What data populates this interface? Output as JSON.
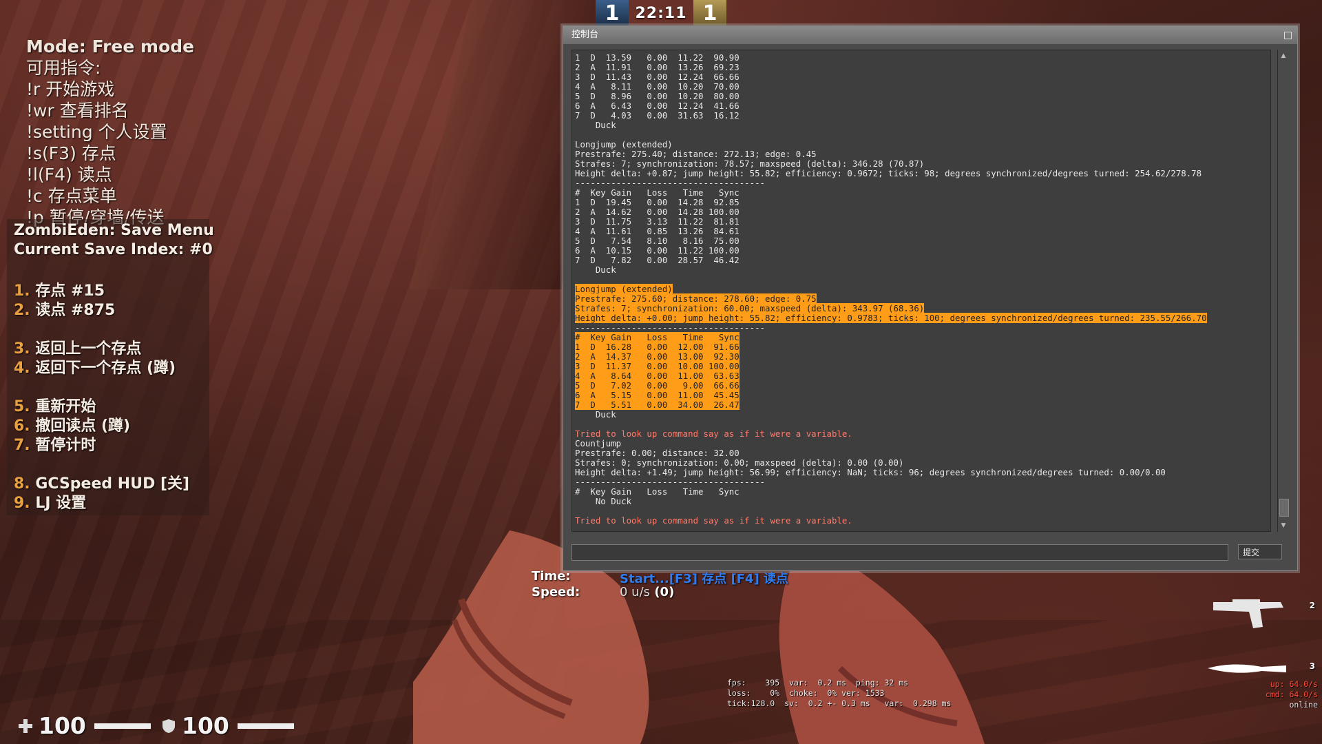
{
  "scoreboard": {
    "ct_score": "1",
    "round_time": "22:11",
    "t_score": "1"
  },
  "chat_menu": {
    "lines": [
      "Mode: Free mode",
      "可用指令:",
      "!r 开始游戏",
      "!wr 查看排名",
      "!setting 个人设置",
      "!s(F3) 存点",
      "!l(F4) 读点",
      "!c 存点菜单",
      "!p 暂停/穿墙/传送"
    ]
  },
  "save_menu": {
    "title": "ZombiEden: Save Menu",
    "index_label": "Current Save Index: #0",
    "items": [
      {
        "num": "1.",
        "label": "存点 #15"
      },
      {
        "num": "2.",
        "label": "读点 #875"
      },
      {
        "num": "3.",
        "label": "返回上一个存点"
      },
      {
        "num": "4.",
        "label": "返回下一个存点 (蹲)"
      },
      {
        "num": "5.",
        "label": "重新开始"
      },
      {
        "num": "6.",
        "label": "撤回读点 (蹲)"
      },
      {
        "num": "7.",
        "label": "暂停计时"
      },
      {
        "num": "8.",
        "label": "GCSpeed HUD [关]"
      },
      {
        "num": "9.",
        "label": "LJ 设置"
      }
    ]
  },
  "console": {
    "title": "控制台",
    "submit_label": "提交",
    "lines": [
      {
        "t": "1  D  13.59   0.00  11.22  90.90"
      },
      {
        "t": "2  A  11.91   0.00  13.26  69.23"
      },
      {
        "t": "3  D  11.43   0.00  12.24  66.66"
      },
      {
        "t": "4  A   8.11   0.00  10.20  70.00"
      },
      {
        "t": "5  D   8.96   0.00  10.20  80.00"
      },
      {
        "t": "6  A   6.43   0.00  12.24  41.66"
      },
      {
        "t": "7  D   4.03   0.00  31.63  16.12"
      },
      {
        "t": "    Duck"
      },
      {
        "t": ""
      },
      {
        "t": "Longjump (extended)"
      },
      {
        "t": "Prestrafe: 275.40; distance: 272.13; edge: 0.45"
      },
      {
        "t": "Strafes: 7; synchronization: 78.57; maxspeed (delta): 346.28 (70.87)"
      },
      {
        "t": "Height delta: +0.87; jump height: 55.82; efficiency: 0.9672; ticks: 98; degrees synchronized/degrees turned: 254.62/278.78"
      },
      {
        "t": "-------------------------------------"
      },
      {
        "t": "#  Key Gain   Loss   Time   Sync"
      },
      {
        "t": "1  D  19.45   0.00  14.28  92.85"
      },
      {
        "t": "2  A  14.62   0.00  14.28 100.00"
      },
      {
        "t": "3  D  11.75   3.13  11.22  81.81"
      },
      {
        "t": "4  A  11.61   0.85  13.26  84.61"
      },
      {
        "t": "5  D   7.54   8.10   8.16  75.00"
      },
      {
        "t": "6  A  10.15   0.00  11.22 100.00"
      },
      {
        "t": "7  D   7.82   0.00  28.57  46.42"
      },
      {
        "t": "    Duck"
      },
      {
        "t": ""
      },
      {
        "t": "Longjump (extended)",
        "hl": true
      },
      {
        "t": "Prestrafe: 275.60; distance: 278.60; edge: 0.75",
        "hl": true
      },
      {
        "t": "Strafes: 7; synchronization: 60.00; maxspeed (delta): 343.97 (68.36)",
        "hl": true
      },
      {
        "t": "Height delta: +0.00; jump height: 55.82; efficiency: 0.9783; ticks: 100; degrees synchronized/degrees turned: 235.55/266.70",
        "hl": true
      },
      {
        "t": "-------------------------------------"
      },
      {
        "t": "#  Key Gain   Loss   Time   Sync",
        "hl": true
      },
      {
        "t": "1  D  16.28   0.00  12.00  91.66",
        "hl": true
      },
      {
        "t": "2  A  14.37   0.00  13.00  92.30",
        "hl": true
      },
      {
        "t": "3  D  11.37   0.00  10.00 100.00",
        "hl": true
      },
      {
        "t": "4  A   8.64   0.00  11.00  63.63",
        "hl": true
      },
      {
        "t": "5  D   7.02   0.00   9.00  66.66",
        "hl": true
      },
      {
        "t": "6  A   5.15   0.00  11.00  45.45",
        "hl": true
      },
      {
        "t": "7  D   5.51   0.00  34.00  26.47",
        "hl": true
      },
      {
        "t": "    Duck"
      },
      {
        "t": ""
      },
      {
        "t": "Tried to look up command say as if it were a variable.",
        "err": true
      },
      {
        "t": "Countjump"
      },
      {
        "t": "Prestrafe: 0.00; distance: 32.00"
      },
      {
        "t": "Strafes: 0; synchronization: 0.00; maxspeed (delta): 0.00 (0.00)"
      },
      {
        "t": "Height delta: +1.49; jump height: 56.99; efficiency: NaN; ticks: 96; degrees synchronized/degrees turned: 0.00/0.00"
      },
      {
        "t": "-------------------------------------"
      },
      {
        "t": "#  Key Gain   Loss   Time   Sync"
      },
      {
        "t": "    No Duck"
      },
      {
        "t": ""
      },
      {
        "t": "Tried to look up command say as if it were a variable.",
        "err": true
      }
    ]
  },
  "timer": {
    "time_label": "Time:",
    "time_value": "Start...[F3] 存点 [F4] 读点",
    "speed_label": "Speed:",
    "speed_value": "0 u/s",
    "speed_extra": "(0)"
  },
  "weapons": {
    "slot_pistol": "2",
    "slot_knife": "3"
  },
  "netgraph": {
    "lines": [
      "fps:    395  var:  0.2 ms  ping: 32 ms",
      "loss:    0%  choke:  0% ver: 1533",
      "tick:128.0  sv:  0.2 +- 0.3 ms   var:  0.298 ms"
    ],
    "up": "up: 64.0/s",
    "cmd": "cmd: 64.0/s",
    "online": "online"
  },
  "vitals": {
    "health": "100",
    "armor": "100"
  },
  "colors": {
    "highlight": "#ff9d18",
    "error_text": "#ff7a6a",
    "menu_number": "#e8a040",
    "timer_blue": "#2e7cf0"
  }
}
